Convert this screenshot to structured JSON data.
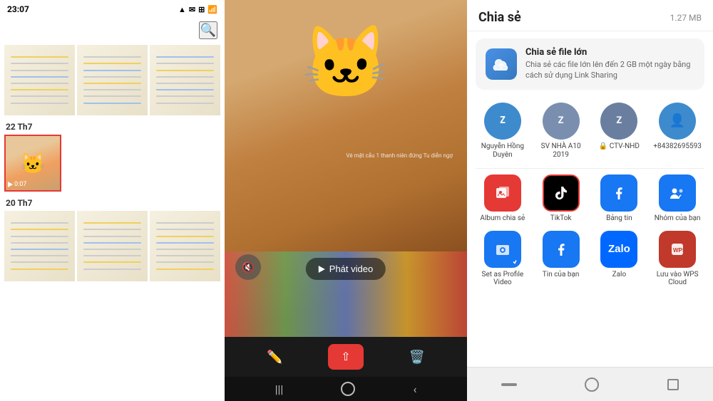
{
  "left_panel": {
    "status_bar": {
      "time": "23:07",
      "icons": "▲ ✉ ☰"
    },
    "search_placeholder": "Search",
    "date_labels": [
      "22 Th7",
      "20 Th7"
    ],
    "video_duration": "0:07"
  },
  "middle_panel": {
    "video_overlay_text": "Vé mặt cẫu 1 thanh niên đứng\nTu diễn ngợ",
    "play_video_label": "Phát video",
    "mute_icon": "🔇",
    "nav_icons": {
      "pencil": "✏",
      "share": "⇧",
      "trash": "🗑"
    }
  },
  "right_panel": {
    "title": "Chia sẻ",
    "file_size": "1.27 MB",
    "large_file_card": {
      "title": "Chia sẻ file lớn",
      "description": "Chia sẻ các file lớn lên đến 2 GB một ngày bằng cách sử dụng Link Sharing"
    },
    "contacts": [
      {
        "name": "Nguyễn Hồng Duyên",
        "color": "#3d8bcd",
        "initial": "Z"
      },
      {
        "name": "SV NHÀ A10 2019",
        "color": "#8a9bc0",
        "initial": "Z"
      },
      {
        "name": "CTV-NHD 🔒",
        "color": "#7a8fb0",
        "initial": "Z"
      },
      {
        "name": "+84382695593",
        "color": "#3d8bcd",
        "initial": "👤"
      }
    ],
    "apps_row1": [
      {
        "name": "Album chia sẻ",
        "icon": "album",
        "color": "#e53935"
      },
      {
        "name": "TikTok",
        "icon": "tiktok",
        "color": "#000",
        "selected": true
      },
      {
        "name": "Bảng tin",
        "icon": "facebook",
        "color": "#1877f2"
      },
      {
        "name": "Nhóm của bạn",
        "icon": "facebook",
        "color": "#1877f2"
      }
    ],
    "apps_row2": [
      {
        "name": "Set as Profile Video",
        "icon": "fb-profile",
        "color": "#1877f2"
      },
      {
        "name": "Tin của bạn",
        "icon": "facebook",
        "color": "#1877f2"
      },
      {
        "name": "Zalo",
        "icon": "zalo",
        "color": "#0068ff"
      },
      {
        "name": "Lưu vào WPS Cloud",
        "icon": "wps",
        "color": "#c0392b"
      }
    ]
  }
}
